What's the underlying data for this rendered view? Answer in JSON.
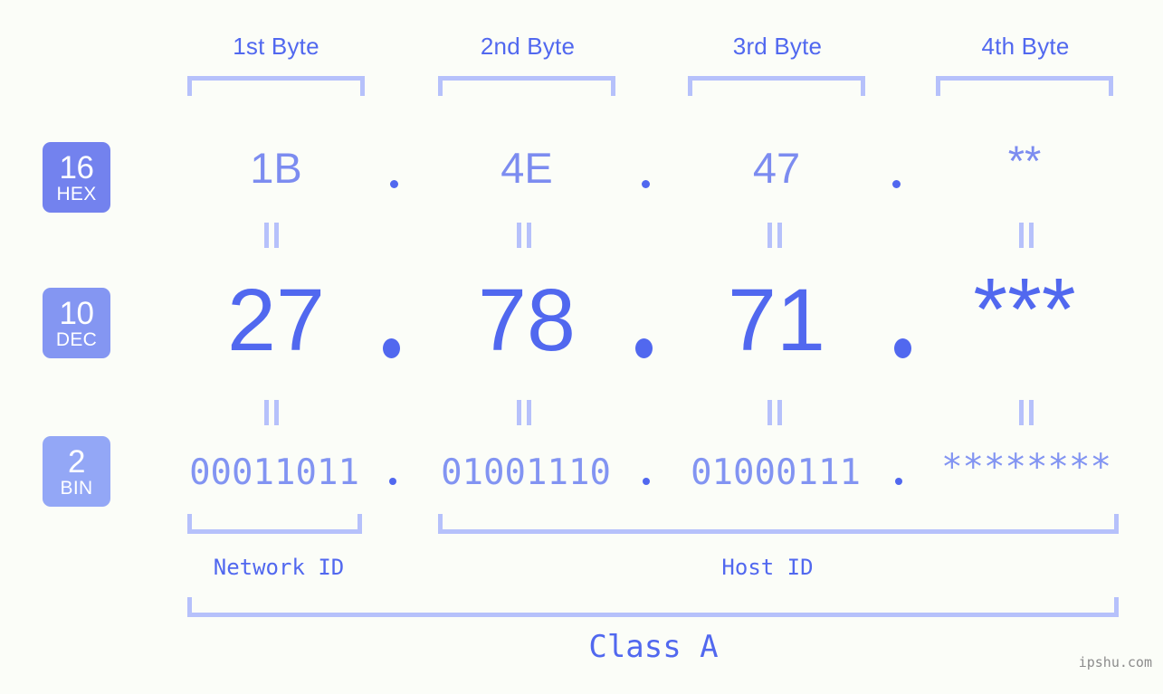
{
  "page": {
    "background": "#fbfdf8",
    "accent": "#5168ef",
    "accent_light": "#7c8cf0",
    "bracket_color": "#b6c1fb",
    "watermark": "ipshu.com"
  },
  "byte_headers": [
    {
      "label": "1st Byte"
    },
    {
      "label": "2nd Byte"
    },
    {
      "label": "3rd Byte"
    },
    {
      "label": "4th Byte"
    }
  ],
  "radix_badges": [
    {
      "number": "16",
      "abbr": "HEX",
      "color": "#7382ee"
    },
    {
      "number": "10",
      "abbr": "DEC",
      "color": "#8496f2"
    },
    {
      "number": "2",
      "abbr": "BIN",
      "color": "#93a7f6"
    }
  ],
  "rows": {
    "hex": {
      "values": [
        "1B",
        "4E",
        "47",
        "**"
      ],
      "separator": "."
    },
    "dec": {
      "values": [
        "27",
        "78",
        "71",
        "***"
      ],
      "separator": "."
    },
    "bin": {
      "values": [
        "00011011",
        "01001110",
        "01000111",
        "********"
      ],
      "separator": "."
    }
  },
  "equals_marks": {
    "symbol": "||",
    "count_per_row": 4
  },
  "segments": [
    {
      "label": "Network ID"
    },
    {
      "label": "Host ID"
    }
  ],
  "class": {
    "label": "Class A"
  }
}
